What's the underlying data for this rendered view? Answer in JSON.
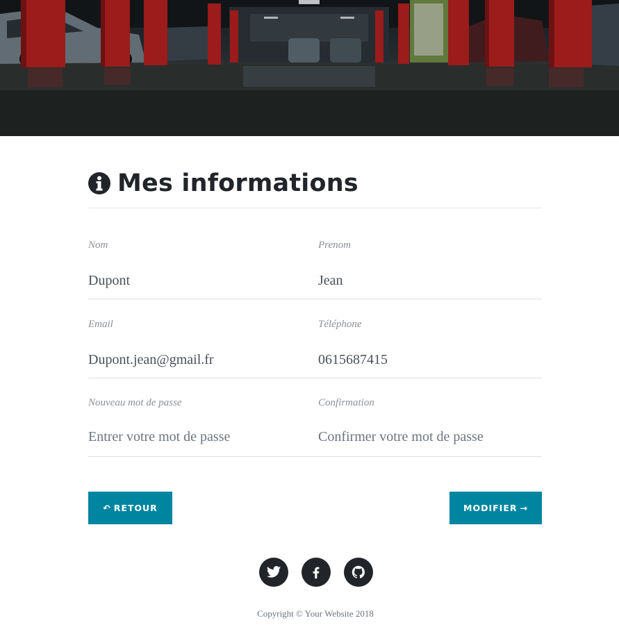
{
  "page": {
    "title": "Mes informations"
  },
  "form": {
    "nom": {
      "label": "Nom",
      "value": "Dupont"
    },
    "prenom": {
      "label": "Prenom",
      "value": "Jean"
    },
    "email": {
      "label": "Email",
      "value": "Dupont.jean@gmail.fr"
    },
    "telephone": {
      "label": "Téléphone",
      "value": "0615687415"
    },
    "new_password": {
      "label": "Nouveau mot de passe",
      "placeholder": "Entrer votre mot de passe"
    },
    "confirmation": {
      "label": "Confirmation",
      "placeholder": "Confirmer votre mot de passe"
    }
  },
  "actions": {
    "back_icon": "↶",
    "back_label": "Retour",
    "modify_label": "Modifier",
    "modify_icon": "→"
  },
  "footer": {
    "social": [
      "twitter-icon",
      "facebook-icon",
      "github-icon"
    ],
    "copyright": "Copyright © Your Website 2018"
  },
  "colors": {
    "accent": "#0085a1",
    "dark": "#212529",
    "label": "#8a9097"
  }
}
